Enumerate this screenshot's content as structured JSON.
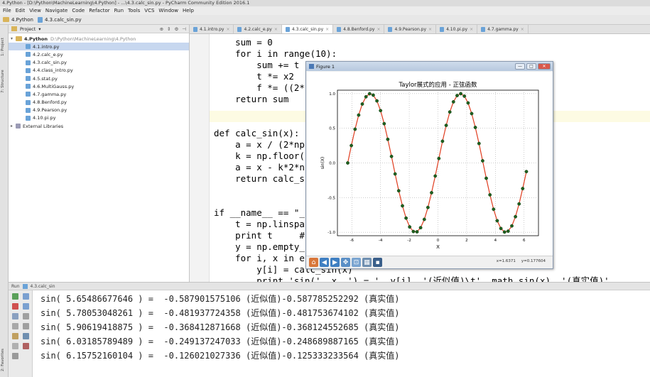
{
  "window": {
    "title": "4.Python - [D:\\Python\\MachineLearning\\4.Python] - ...\\4.3.calc_sin.py - PyCharm Community Edition 2016.1"
  },
  "menu": [
    "File",
    "Edit",
    "View",
    "Navigate",
    "Code",
    "Refactor",
    "Run",
    "Tools",
    "VCS",
    "Window",
    "Help"
  ],
  "breadcrumb": {
    "project": "4.Python",
    "file": "4.3.calc_sin.py"
  },
  "project_panel": {
    "header": "Project",
    "root": "4.Python",
    "root_path": "D:\\Python\\MachineLearning\\4.Python",
    "files": [
      "4.1.intro.py",
      "4.2.calc_e.py",
      "4.3.calc_sin.py",
      "4.4.class_intro.py",
      "4.5.stat.py",
      "4.6.MultiGauss.py",
      "4.7.gamma.py",
      "4.8.Benford.py",
      "4.9.Pearson.py",
      "4.10.pi.py"
    ],
    "selected_index": 0,
    "external": "External Libraries"
  },
  "left_strip": {
    "project_label": "1: Project",
    "structure_label": "7: Structure",
    "favorites_label": "2: Favorites"
  },
  "tabs": [
    "4.1.intro.py",
    "4.2.calc_e.py",
    "4.3.calc_sin.py",
    "4.8.Benford.py",
    "4.9.Pearson.py",
    "4.10.pi.py",
    "4.7.gamma.py"
  ],
  "active_tab": 2,
  "code": [
    "    sum = 0",
    "    for i in range(10):",
    "        sum += t",
    "        t *= x2",
    "        f *= ((2*",
    "    return sum",
    "",
    "",
    "def calc_sin(x):",
    "    a = x / (2*np",
    "    k = np.floor(",
    "    a = x - k*2*n",
    "    return calc_s",
    "",
    "",
    "if __name__ == \"_",
    "    t = np.linspa",
    "    print t     #",
    "    y = np.empty_",
    "    for i, x in e",
    "        y[i] = calc_sin(x)",
    "        print 'sin(', x, ') = ', y[i], '(近似值)\\t', math.sin(x), '(真实值)'"
  ],
  "figure": {
    "window_title": "Figure 1",
    "coord_x": "x=1.6371",
    "coord_y": "y=0.177604"
  },
  "chart_data": {
    "type": "line",
    "title": "Taylor展式的应用 - 正弦函数",
    "xlabel": "X",
    "ylabel": "sin(X)",
    "xlim": [
      -7,
      7
    ],
    "ylim": [
      -1.05,
      1.05
    ],
    "xticks": [
      -6,
      -4,
      -2,
      0,
      2,
      4,
      6
    ],
    "yticks": [
      -1.0,
      -0.5,
      0.0,
      0.5,
      1.0
    ],
    "grid": true,
    "x_range": [
      -6.283,
      6.158
    ],
    "n_points": 50,
    "series": [
      {
        "name": "",
        "function": "sin",
        "line_color": "#e03c1e",
        "marker_color": "#1f5f1f"
      }
    ]
  },
  "run": {
    "tab_label": "Run",
    "config": "4.3.calc_sin",
    "output": [
      "sin( 5.65486677646 ) =  -0.587901575106 (近似值)-0.587785252292 (真实值)",
      "sin( 5.78053048261 ) =  -0.481937724358 (近似值)-0.481753674102 (真实值)",
      "sin( 5.90619418875 ) =  -0.368412871668 (近似值)-0.368124552685 (真实值)",
      "sin( 6.03185789489 ) =  -0.249137247033 (近似值)-0.248689887165 (真实值)",
      "sin( 6.15752160104 ) =  -0.126021027336 (近似值)-0.125333233564 (真实值)"
    ]
  }
}
